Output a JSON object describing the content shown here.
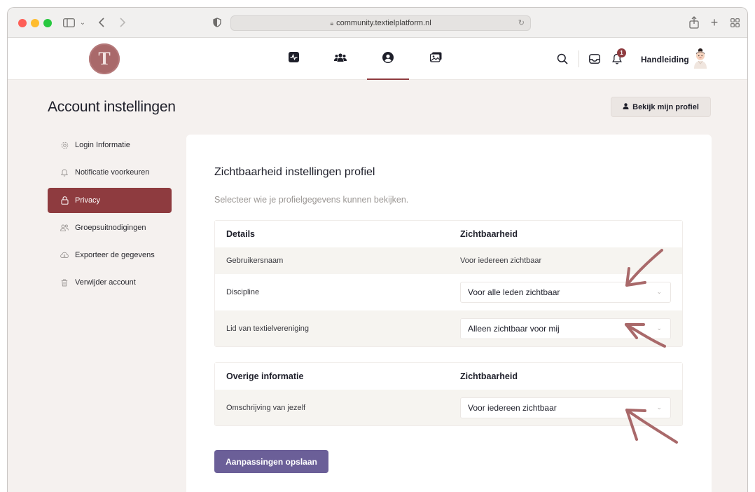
{
  "browser": {
    "url": "community.textielplatform.nl"
  },
  "site": {
    "logo_letter": "T",
    "username": "Handleiding",
    "notification_count": "1",
    "nav": [
      {
        "name": "activity"
      },
      {
        "name": "members"
      },
      {
        "name": "profile",
        "active": true
      },
      {
        "name": "media"
      }
    ]
  },
  "page": {
    "title": "Account instellingen",
    "view_profile_label": "Bekijk mijn profiel"
  },
  "sidebar": {
    "items": [
      {
        "label": "Login Informatie",
        "icon": "gear-icon"
      },
      {
        "label": "Notificatie voorkeuren",
        "icon": "bell-icon"
      },
      {
        "label": "Privacy",
        "icon": "lock-icon",
        "active": true
      },
      {
        "label": "Groepsuitnodigingen",
        "icon": "group-icon"
      },
      {
        "label": "Exporteer de gegevens",
        "icon": "cloud-download-icon"
      },
      {
        "label": "Verwijder account",
        "icon": "trash-icon"
      }
    ]
  },
  "privacy": {
    "title": "Zichtbaarheid instellingen profiel",
    "subtitle": "Selecteer wie je profielgegevens kunnen bekijken.",
    "table1": {
      "col1": "Details",
      "col2": "Zichtbaarheid",
      "rows": [
        {
          "field": "Gebruikersnaam",
          "visibility": "Voor iedereen zichtbaar"
        },
        {
          "field": "Discipline",
          "visibility": "Voor alle leden zichtbaar"
        },
        {
          "field": "Lid van textielvereniging",
          "visibility": "Alleen zichtbaar voor mij"
        }
      ]
    },
    "table2": {
      "col1": "Overige informatie",
      "col2": "Zichtbaarheid",
      "rows": [
        {
          "field": "Omschrijving van jezelf",
          "visibility": "Voor iedereen zichtbaar"
        }
      ]
    },
    "save_label": "Aanpassingen opslaan"
  },
  "colors": {
    "accent": "#8e3b3f",
    "button": "#6b5f98",
    "annotation_arrow": "#a9696a"
  }
}
